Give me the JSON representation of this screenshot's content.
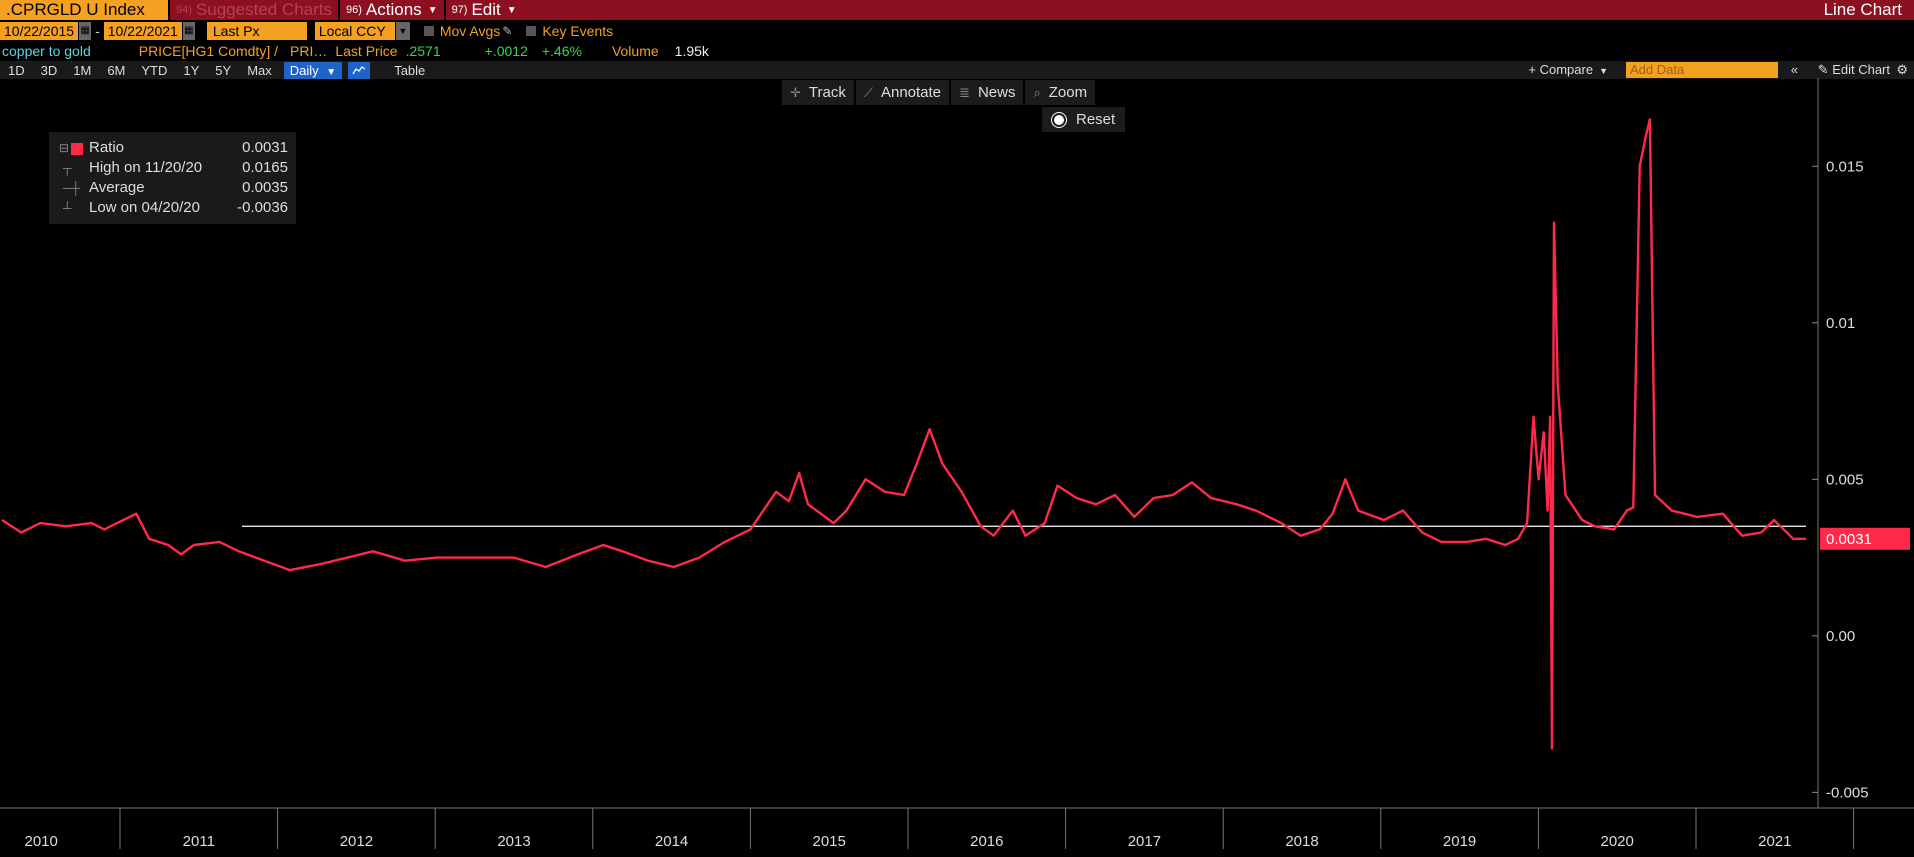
{
  "topbar": {
    "ticker": ".CPRGLD U Index",
    "suggested_num": "94)",
    "suggested_label": "Suggested Charts",
    "actions_num": "96)",
    "actions_label": "Actions",
    "edit_num": "97)",
    "edit_label": "Edit",
    "chart_type": "Line Chart"
  },
  "controls": {
    "start_date": "10/22/2015",
    "end_date": "10/22/2021",
    "field": "Last Px",
    "currency": "Local CCY",
    "mov_avgs": "Mov Avgs",
    "key_events": "Key Events"
  },
  "info": {
    "name": "copper to gold",
    "formula": "PRICE[HG1 Comdty] /",
    "formula_more": "PRI…",
    "last_price_label": "Last Price",
    "last_price": ".2571",
    "change": "+.0012",
    "change_pct": "+.46%",
    "volume_label": "Volume",
    "volume": "1.95k"
  },
  "toolbar": {
    "ranges": [
      "1D",
      "3D",
      "1M",
      "6M",
      "YTD",
      "1Y",
      "5Y",
      "Max"
    ],
    "frequency": "Daily",
    "table": "Table",
    "compare": "Compare",
    "add_data_placeholder": "Add Data",
    "edit_chart": "Edit Chart"
  },
  "tools": {
    "track": "Track",
    "annotate": "Annotate",
    "news": "News",
    "zoom": "Zoom",
    "reset": "Reset"
  },
  "legend": {
    "series_label": "Ratio",
    "series_value": "0.0031",
    "high_label": "High on 11/20/20",
    "high_value": "0.0165",
    "avg_label": "Average",
    "avg_value": "0.0035",
    "low_label": "Low on 04/20/20",
    "low_value": "-0.0036"
  },
  "colors": {
    "series": "#ff2a4a",
    "average_line": "#ffffff",
    "accent": "#f4a020",
    "title_bar": "#8c1020"
  },
  "chart_data": {
    "type": "line",
    "title": "",
    "xlabel": "",
    "ylabel": "",
    "x_ticks": [
      "2010",
      "2011",
      "2012",
      "2013",
      "2014",
      "2015",
      "2016",
      "2017",
      "2018",
      "2019",
      "2020",
      "2021"
    ],
    "y_ticks": [
      0.015,
      0.01,
      0.005,
      0.0,
      -0.005
    ],
    "y_tick_labels": [
      "0.015",
      "0.01",
      "0.005",
      "0.00",
      "-0.005"
    ],
    "ylim": [
      -0.0055,
      0.0175
    ],
    "xlim": [
      2009.7,
      2021.85
    ],
    "last_value_label": "0.0031",
    "average": 0.0035,
    "series": [
      {
        "name": "Ratio",
        "points": [
          [
            2009.7,
            0.0037
          ],
          [
            2009.85,
            0.0033
          ],
          [
            2010.0,
            0.0036
          ],
          [
            2010.2,
            0.0035
          ],
          [
            2010.4,
            0.0036
          ],
          [
            2010.5,
            0.0034
          ],
          [
            2010.6,
            0.0036
          ],
          [
            2010.75,
            0.0039
          ],
          [
            2010.85,
            0.0031
          ],
          [
            2011.0,
            0.0029
          ],
          [
            2011.1,
            0.0026
          ],
          [
            2011.2,
            0.0029
          ],
          [
            2011.4,
            0.003
          ],
          [
            2011.55,
            0.0027
          ],
          [
            2011.75,
            0.0024
          ],
          [
            2011.95,
            0.0021
          ],
          [
            2012.2,
            0.0023
          ],
          [
            2012.4,
            0.0025
          ],
          [
            2012.6,
            0.0027
          ],
          [
            2012.85,
            0.0024
          ],
          [
            2013.1,
            0.0025
          ],
          [
            2013.4,
            0.0025
          ],
          [
            2013.7,
            0.0025
          ],
          [
            2013.95,
            0.0022
          ],
          [
            2014.2,
            0.0026
          ],
          [
            2014.4,
            0.0029
          ],
          [
            2014.55,
            0.0027
          ],
          [
            2014.75,
            0.0024
          ],
          [
            2014.95,
            0.0022
          ],
          [
            2015.15,
            0.0025
          ],
          [
            2015.35,
            0.003
          ],
          [
            2015.55,
            0.0034
          ],
          [
            2015.75,
            0.0046
          ],
          [
            2015.85,
            0.0043
          ],
          [
            2015.93,
            0.0052
          ],
          [
            2016.0,
            0.0042
          ],
          [
            2016.2,
            0.0036
          ],
          [
            2016.3,
            0.004
          ],
          [
            2016.45,
            0.005
          ],
          [
            2016.6,
            0.0046
          ],
          [
            2016.75,
            0.0045
          ],
          [
            2016.85,
            0.0055
          ],
          [
            2016.95,
            0.0066
          ],
          [
            2017.05,
            0.0055
          ],
          [
            2017.2,
            0.0046
          ],
          [
            2017.35,
            0.0035
          ],
          [
            2017.45,
            0.0032
          ],
          [
            2017.6,
            0.004
          ],
          [
            2017.7,
            0.0032
          ],
          [
            2017.85,
            0.0036
          ],
          [
            2017.95,
            0.0048
          ],
          [
            2018.1,
            0.0044
          ],
          [
            2018.25,
            0.0042
          ],
          [
            2018.4,
            0.0045
          ],
          [
            2018.55,
            0.0038
          ],
          [
            2018.7,
            0.0044
          ],
          [
            2018.85,
            0.0045
          ],
          [
            2019.0,
            0.0049
          ],
          [
            2019.15,
            0.0044
          ],
          [
            2019.35,
            0.0042
          ],
          [
            2019.5,
            0.004
          ],
          [
            2019.7,
            0.0036
          ],
          [
            2019.85,
            0.0032
          ],
          [
            2020.0,
            0.0034
          ],
          [
            2020.1,
            0.0039
          ],
          [
            2020.2,
            0.005
          ],
          [
            2020.3,
            0.004
          ],
          [
            2020.5,
            0.0037
          ],
          [
            2020.65,
            0.004
          ],
          [
            2020.8,
            0.0033
          ],
          [
            2020.95,
            0.003
          ],
          [
            2021.15,
            0.003
          ],
          [
            2021.3,
            0.0031
          ],
          [
            2021.45,
            0.0029
          ],
          [
            2021.55,
            0.0031
          ],
          [
            2021.62,
            0.0036
          ],
          [
            2021.67,
            0.007
          ],
          [
            2021.71,
            0.005
          ],
          [
            2021.75,
            0.0065
          ],
          [
            2021.78,
            0.004
          ],
          [
            2021.8,
            0.007
          ],
          [
            2021.815,
            -0.0036
          ],
          [
            2021.83,
            0.0132
          ],
          [
            2021.86,
            0.008
          ],
          [
            2021.92,
            0.0045
          ],
          [
            2022.05,
            0.0037
          ],
          [
            2022.15,
            0.0035
          ],
          [
            2022.3,
            0.0034
          ],
          [
            2022.4,
            0.004
          ],
          [
            2022.45,
            0.0041
          ],
          [
            2022.5,
            0.015
          ],
          [
            2022.55,
            0.016
          ],
          [
            2022.58,
            0.0165
          ],
          [
            2022.62,
            0.0045
          ],
          [
            2022.75,
            0.004
          ],
          [
            2022.95,
            0.0038
          ],
          [
            2023.15,
            0.0039
          ],
          [
            2023.3,
            0.0032
          ],
          [
            2023.45,
            0.0033
          ],
          [
            2023.55,
            0.0037
          ],
          [
            2023.7,
            0.0031
          ],
          [
            2023.8,
            0.0031
          ]
        ]
      }
    ]
  }
}
